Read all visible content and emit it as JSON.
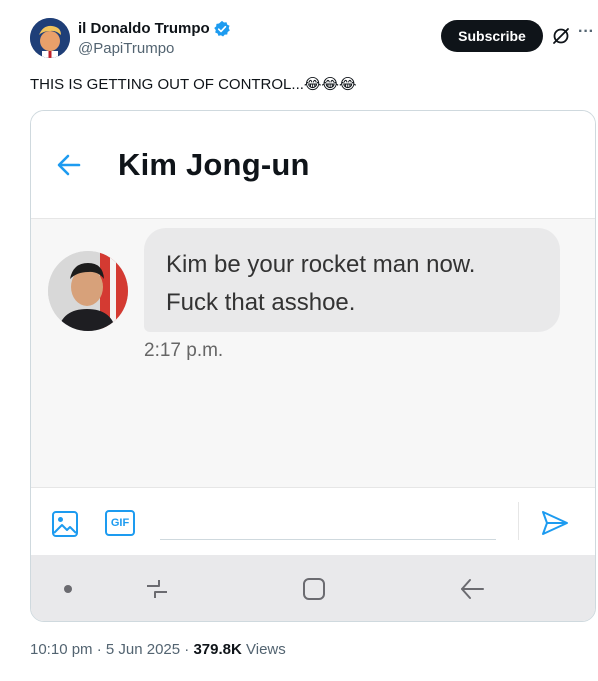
{
  "author": {
    "display_name": "il Donaldo Trumpo",
    "handle": "@PapiTrumpo",
    "verified": true,
    "subscribe_label": "Subscribe"
  },
  "tweet": {
    "text": "THIS IS GETTING OUT OF CONTROL...😂😂😂"
  },
  "screenshot": {
    "contact_name": "Kim Jong-un",
    "message_lines": [
      "Kim be your rocket man now.",
      "Fuck that asshoe."
    ],
    "message_time": "2:17 p.m.",
    "gif_label": "GIF",
    "input_placeholder": ""
  },
  "meta": {
    "time": "10:10 pm",
    "separator": "·",
    "date": "5 Jun 2025",
    "views_count": "379.8K",
    "views_label": "Views"
  },
  "colors": {
    "accent": "#1d9bf0",
    "subscribe_bg": "#0f1419",
    "bubble_bg": "#e9e9ea",
    "navbar_bg": "#e9e9eb"
  },
  "icons": [
    "verified-badge-icon",
    "grok-icon",
    "more-icon",
    "back-arrow-icon",
    "image-icon",
    "gif-icon",
    "send-icon",
    "recent-apps-icon",
    "home-icon",
    "nav-back-icon"
  ]
}
